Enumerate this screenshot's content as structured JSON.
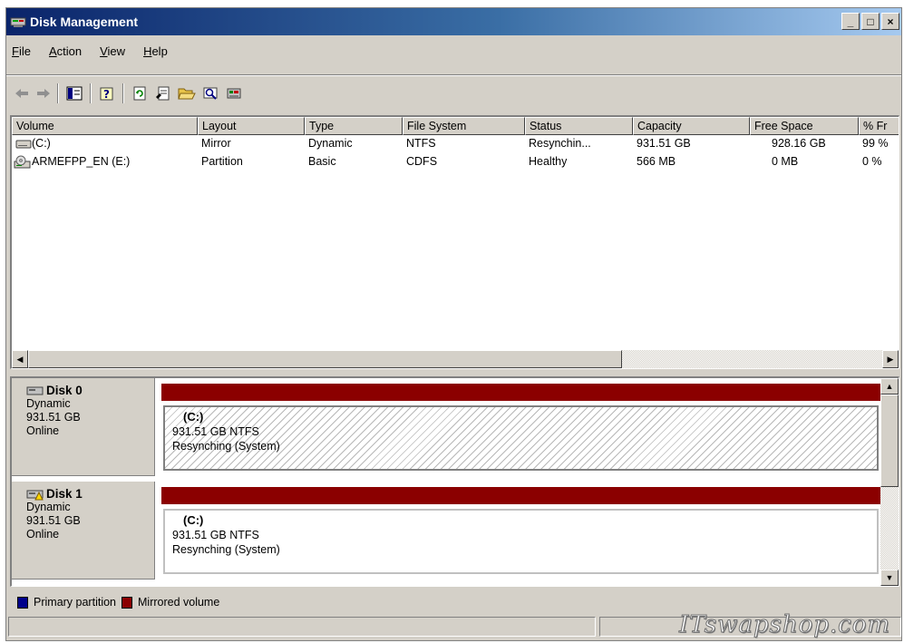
{
  "window": {
    "title": "Disk Management"
  },
  "window_buttons": [
    "_",
    "□",
    "×"
  ],
  "menu": [
    {
      "label": "File",
      "accel": "F",
      "rest": "ile"
    },
    {
      "label": "Action",
      "accel": "A",
      "rest": "ction"
    },
    {
      "label": "View",
      "accel": "V",
      "rest": "iew"
    },
    {
      "label": "Help",
      "accel": "H",
      "rest": "elp"
    }
  ],
  "toolbar": {
    "icons": [
      "back-arrow-icon",
      "forward-arrow-icon",
      "console-tree-icon",
      "help-icon",
      "refresh-icon",
      "properties-icon",
      "open-folder-icon",
      "search-icon",
      "disk-icon"
    ]
  },
  "volume_list": {
    "columns": [
      "Volume",
      "Layout",
      "Type",
      "File System",
      "Status",
      "Capacity",
      "Free Space",
      "% Fr"
    ],
    "rows": [
      {
        "icon": "volume-drive-icon",
        "volume": "(C:)",
        "layout": "Mirror",
        "type": "Dynamic",
        "fs": "NTFS",
        "status": "Resynchin...",
        "capacity": "931.51 GB",
        "free": "928.16 GB",
        "pct": "99 %"
      },
      {
        "icon": "cdrom-drive-icon",
        "volume": "ARMEFPP_EN (E:)",
        "layout": "Partition",
        "type": "Basic",
        "fs": "CDFS",
        "status": "Healthy",
        "capacity": "566 MB",
        "free": "0 MB",
        "pct": "0 %"
      }
    ]
  },
  "disks": [
    {
      "name": "Disk 0",
      "type": "Dynamic",
      "size": "931.51 GB",
      "state": "Online",
      "partition": {
        "name": "(C:)",
        "detail": "931.51 GB NTFS",
        "status": "Resynching (System)",
        "selected": true
      }
    },
    {
      "name": "Disk 1",
      "type": "Dynamic",
      "size": "931.51 GB",
      "state": "Online",
      "partition": {
        "name": "(C:)",
        "detail": "931.51 GB NTFS",
        "status": "Resynching (System)",
        "selected": false
      }
    }
  ],
  "legend": [
    {
      "label": "Primary partition",
      "color": "#00008b"
    },
    {
      "label": "Mirrored volume",
      "color": "#8b0000"
    }
  ],
  "colors": {
    "mirror_bar": "#8b0000",
    "titlebar_start": "#0a246a",
    "titlebar_end": "#a6caf0"
  },
  "watermark": "ITswapshop.com"
}
